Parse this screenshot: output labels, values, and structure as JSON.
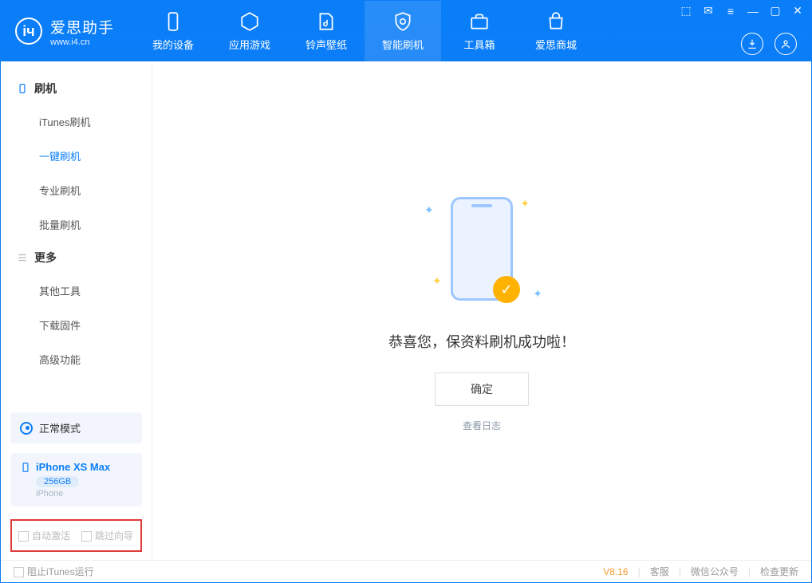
{
  "app": {
    "name": "爱思助手",
    "url": "www.i4.cn"
  },
  "nav": [
    {
      "id": "device",
      "label": "我的设备"
    },
    {
      "id": "apps",
      "label": "应用游戏"
    },
    {
      "id": "ringtone",
      "label": "铃声壁纸"
    },
    {
      "id": "flash",
      "label": "智能刷机"
    },
    {
      "id": "tools",
      "label": "工具箱"
    },
    {
      "id": "store",
      "label": "爱思商城"
    }
  ],
  "sidebar": {
    "section1_title": "刷机",
    "items1": [
      {
        "label": "iTunes刷机"
      },
      {
        "label": "一键刷机"
      },
      {
        "label": "专业刷机"
      },
      {
        "label": "批量刷机"
      }
    ],
    "section2_title": "更多",
    "items2": [
      {
        "label": "其他工具"
      },
      {
        "label": "下载固件"
      },
      {
        "label": "高级功能"
      }
    ],
    "mode_label": "正常模式",
    "device": {
      "name": "iPhone XS Max",
      "capacity": "256GB",
      "type": "iPhone"
    },
    "check1": "自动激活",
    "check2": "跳过向导"
  },
  "main": {
    "success_text": "恭喜您，保资料刷机成功啦！",
    "ok_button": "确定",
    "log_link": "查看日志"
  },
  "footer": {
    "block_itunes": "阻止iTunes运行",
    "version": "V8.16",
    "link1": "客服",
    "link2": "微信公众号",
    "link3": "检查更新"
  }
}
